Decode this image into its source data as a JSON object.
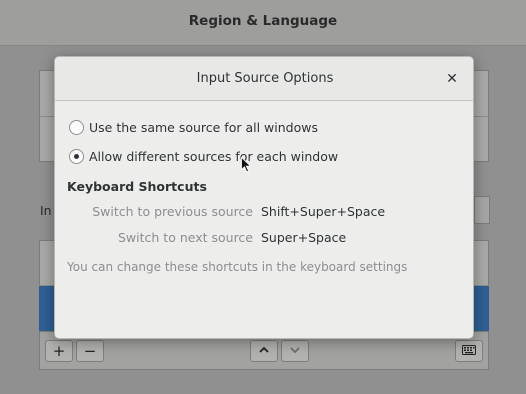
{
  "background_window": {
    "title": "Region & Language",
    "section_label_fragment": "In"
  },
  "toolbar": {
    "add_label": "+",
    "remove_label": "−"
  },
  "dialog": {
    "title": "Input Source Options",
    "close_glyph": "✕",
    "options": [
      {
        "label": "Use the same source for all windows",
        "checked": false
      },
      {
        "label": "Allow different sources for each window",
        "checked": true
      }
    ],
    "shortcuts_heading": "Keyboard Shortcuts",
    "shortcuts": [
      {
        "label": "Switch to previous source",
        "value": "Shift+Super+Space"
      },
      {
        "label": "Switch to next source",
        "value": "Super+Space"
      }
    ],
    "hint": "You can change these shortcuts in the keyboard settings"
  }
}
